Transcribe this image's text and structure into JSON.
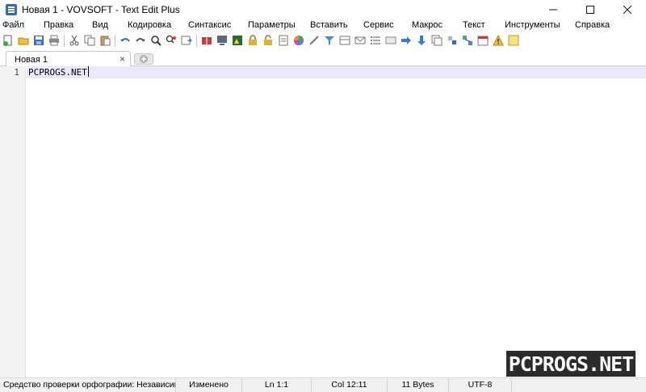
{
  "window": {
    "title": "Новая 1 - VOVSOFT - Text Edit Plus"
  },
  "menu": [
    "Файл",
    "Правка",
    "Вид",
    "Кодировка",
    "Синтаксис",
    "Параметры",
    "Вставить",
    "Сервис",
    "Макрос",
    "Текст",
    "Инструменты",
    "Справка"
  ],
  "tabs": [
    {
      "label": "Новая 1",
      "close": "×"
    }
  ],
  "editor": {
    "line_numbers": [
      "1"
    ],
    "lines": [
      "PCPROGS.NET"
    ]
  },
  "watermark": "PCPROGS.NET",
  "status": {
    "spellcheck": "Средство проверки орфографии: Независимо от",
    "modified": "Изменено",
    "line": "Ln 1:1",
    "col": "Col 12:11",
    "size": "11 Bytes",
    "encoding": "UTF-8"
  },
  "colors": {
    "current_line": "#e8e8ff",
    "accent": "#2f6fb8"
  }
}
